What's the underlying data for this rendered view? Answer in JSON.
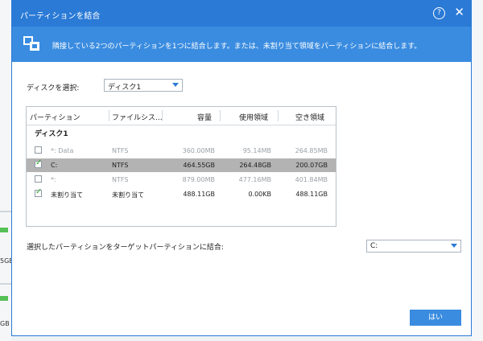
{
  "background": {
    "left_labels": [
      "5GB",
      "GB"
    ]
  },
  "dialog": {
    "title": "パーティションを結合",
    "help_glyph": "?",
    "close_glyph": "✕",
    "banner_text": "隣接している2つのパーティションを1つに結合します。または、未割り当て領域をパーティションに結合します。",
    "disk_select_label": "ディスクを選択:",
    "disk_select_value": "ディスク1",
    "table": {
      "columns": [
        "パーティション",
        "ファイルシス...",
        "容量",
        "使用領域",
        "空き領域"
      ],
      "group_label": "ディスク1",
      "rows": [
        {
          "checked": false,
          "dim": true,
          "selected": false,
          "partition": "*: Data",
          "fs": "NTFS",
          "capacity": "360.00MB",
          "used": "95.14MB",
          "free": "264.85MB"
        },
        {
          "checked": true,
          "dim": false,
          "selected": true,
          "partition": "C:",
          "fs": "NTFS",
          "capacity": "464.55GB",
          "used": "264.48GB",
          "free": "200.07GB"
        },
        {
          "checked": false,
          "dim": true,
          "selected": false,
          "partition": "*:",
          "fs": "NTFS",
          "capacity": "879.00MB",
          "used": "477.16MB",
          "free": "401.84MB"
        },
        {
          "checked": true,
          "dim": false,
          "selected": false,
          "partition": "未割り当て",
          "fs": "未割り当て",
          "capacity": "488.11GB",
          "used": "0.00KB",
          "free": "488.11GB"
        }
      ]
    },
    "target_label": "選択したパーティションをターゲットパーティションに結合:",
    "target_value": "C:",
    "ok_button": "はい"
  },
  "colors": {
    "accent": "#2a7ad6",
    "banner": "#3a8ce0",
    "selected_row": "#b3b3b3",
    "check": "#2da82d"
  }
}
